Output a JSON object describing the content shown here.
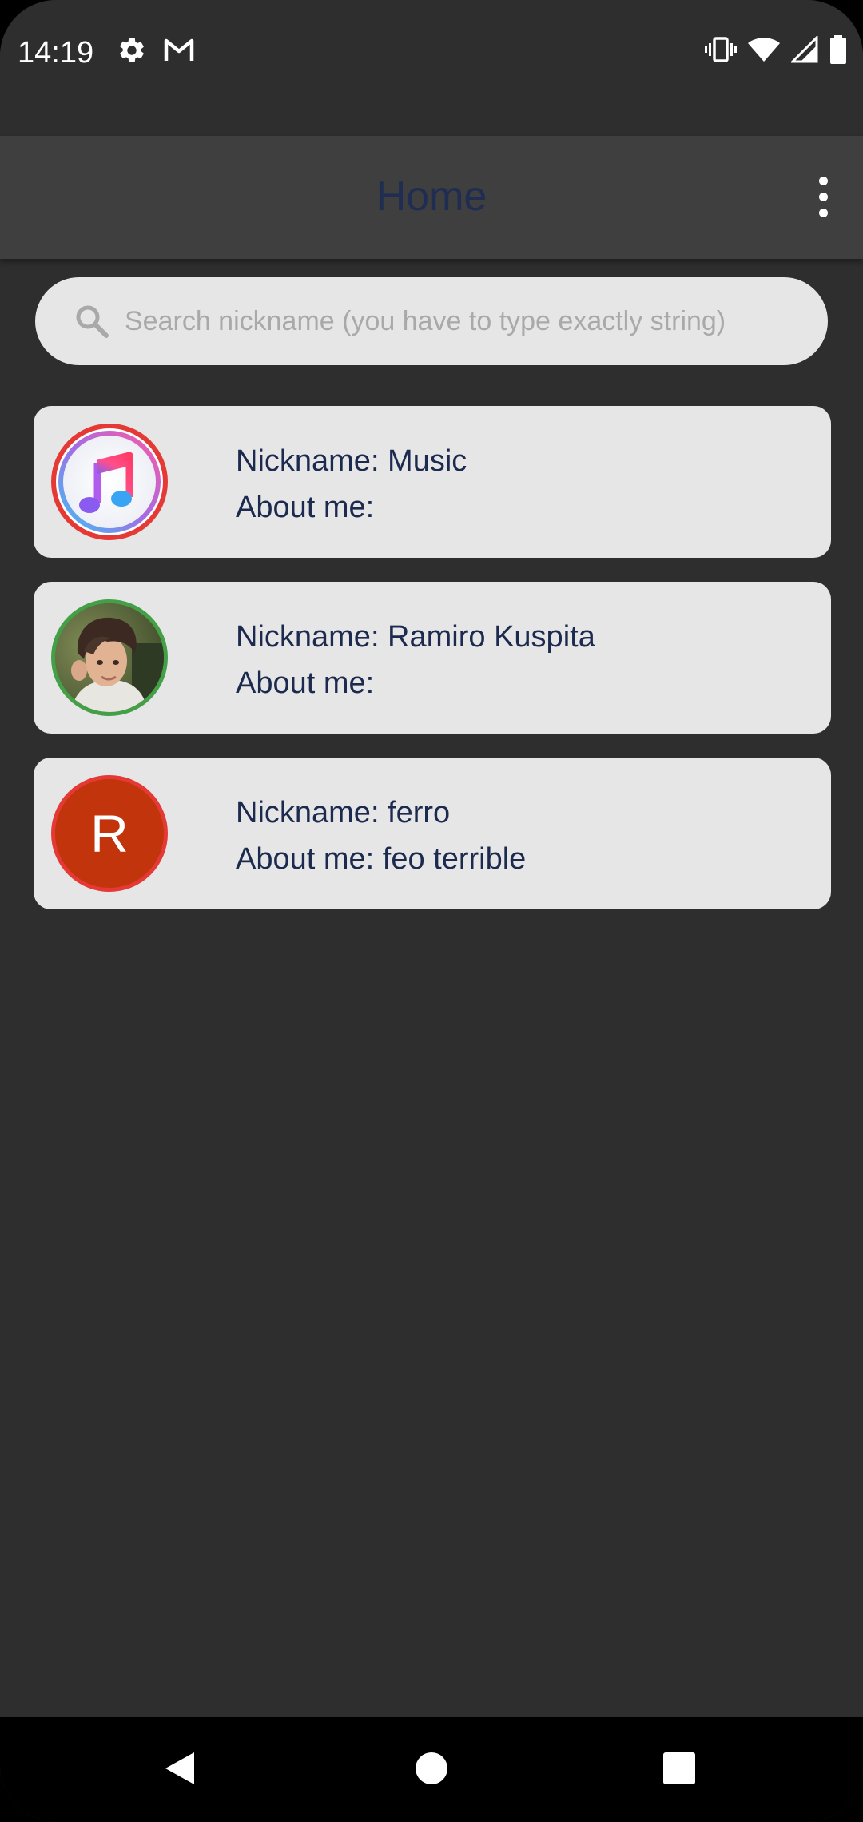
{
  "status_bar": {
    "time": "14:19",
    "left_icons": [
      "settings-icon",
      "gmail-icon"
    ],
    "right_icons": [
      "vibrate-icon",
      "wifi-icon",
      "signal-icon",
      "battery-icon"
    ]
  },
  "app_bar": {
    "title": "Home",
    "title_color": "#1f2d52",
    "menu_icon": "more-vert-icon"
  },
  "search": {
    "placeholder": "Search nickname (you have to type exactly string)",
    "value": ""
  },
  "users": [
    {
      "nickname_line": "Nickname: Music",
      "about_line": "About me:",
      "avatar": "music-app-icon",
      "ring_color": "#e53935"
    },
    {
      "nickname_line": "Nickname: Ramiro Kuspita",
      "about_line": "About me:",
      "avatar": "profile-photo",
      "ring_color": "#43a047"
    },
    {
      "nickname_line": "Nickname: ferro",
      "about_line": "About me: feo terrible",
      "avatar": "letter-avatar",
      "avatar_letter": "R",
      "avatar_color": "#c1340c",
      "ring_color": "#e53935"
    }
  ],
  "nav_bar": {
    "buttons": [
      "back-icon",
      "home-icon",
      "recents-icon"
    ]
  }
}
